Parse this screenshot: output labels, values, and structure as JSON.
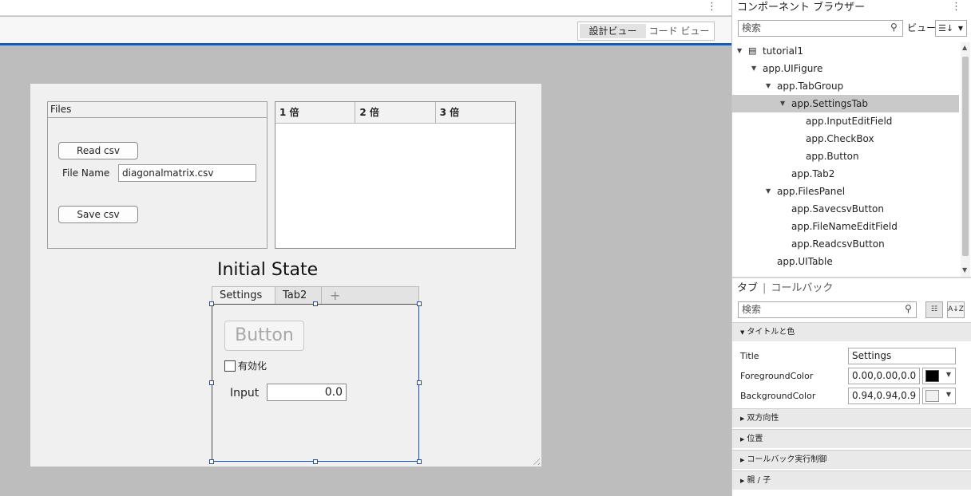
{
  "design": {
    "view_toggle": {
      "design_view": "設計ビュー",
      "code_view": "コード ビュー"
    },
    "files_panel": {
      "title": "Files",
      "read_button": "Read csv",
      "save_button": "Save csv",
      "filename_label": "File Name",
      "filename_value": "diagonalmatrix.csv"
    },
    "table": {
      "columns": [
        "1 倍",
        "2 倍",
        "3 倍"
      ]
    },
    "label_text": "Initial State",
    "tabgroup": {
      "tabs": [
        "Settings",
        "Tab2"
      ],
      "add_glyph": "+",
      "button_label": "Button",
      "checkbox_label": "有効化",
      "input_label": "Input",
      "input_value": "0.0"
    }
  },
  "browser": {
    "title": "コンポーネント ブラウザー",
    "search_placeholder": "検索",
    "view_label": "ビュー:",
    "tree": [
      {
        "label": "tutorial1",
        "level": 0,
        "expanded": true,
        "selected": false
      },
      {
        "label": "app.UIFigure",
        "level": 1,
        "expanded": true,
        "selected": false
      },
      {
        "label": "app.TabGroup",
        "level": 2,
        "expanded": true,
        "selected": false
      },
      {
        "label": "app.SettingsTab",
        "level": 3,
        "expanded": true,
        "selected": true
      },
      {
        "label": "app.InputEditField",
        "level": 4,
        "expanded": null,
        "selected": false
      },
      {
        "label": "app.CheckBox",
        "level": 4,
        "expanded": null,
        "selected": false
      },
      {
        "label": "app.Button",
        "level": 4,
        "expanded": null,
        "selected": false
      },
      {
        "label": "app.Tab2",
        "level": 3,
        "expanded": null,
        "selected": false
      },
      {
        "label": "app.FilesPanel",
        "level": 2,
        "expanded": true,
        "selected": false
      },
      {
        "label": "app.SavecsvButton",
        "level": 3,
        "expanded": null,
        "selected": false
      },
      {
        "label": "app.FileNameEditField",
        "level": 3,
        "expanded": null,
        "selected": false
      },
      {
        "label": "app.ReadcsvButton",
        "level": 3,
        "expanded": null,
        "selected": false
      },
      {
        "label": "app.UITable",
        "level": 2,
        "expanded": null,
        "selected": false
      }
    ]
  },
  "inspector": {
    "tab_properties": "タブ",
    "tab_callbacks": "コールバック",
    "search_placeholder": "検索",
    "sections": {
      "title_color": "タイトルと色",
      "interactivity": "双方向性",
      "position": "位置",
      "callback_exec": "コールバック実行制御",
      "parent_child": "親 / 子"
    },
    "props": {
      "title_label": "Title",
      "title_value": "Settings",
      "fg_label": "ForegroundColor",
      "fg_value": "0.00,0.00,0.0",
      "bg_label": "BackgroundColor",
      "bg_value": "0.94,0.94,0.9"
    },
    "colors": {
      "foreground": "#000000",
      "background": "#f0f0f0"
    }
  }
}
